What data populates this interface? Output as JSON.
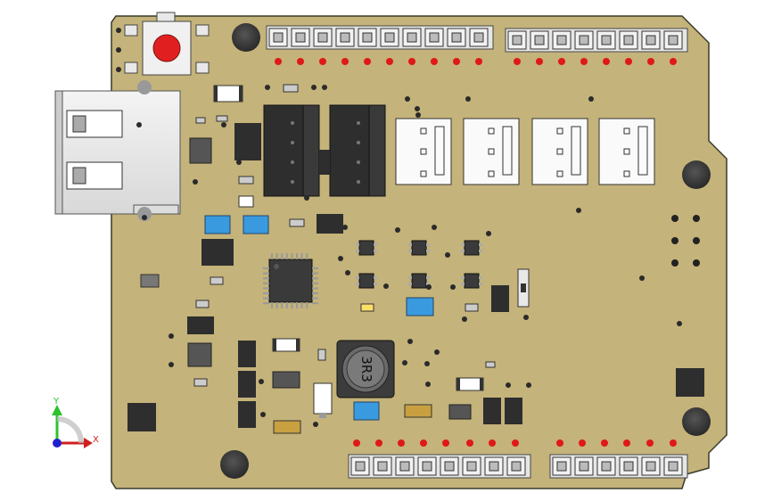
{
  "board": {
    "color": "#c4b37a",
    "outline_color": "#3a3a2a",
    "inductor_marking": "3R3",
    "button_color": "#e02020",
    "led_color": "#e01818",
    "chip_color": "#2e2e2e",
    "blue_component_color": "#3a9ae0",
    "cap_tan_color": "#c8a040"
  },
  "axis_triad": {
    "y_label": "Y",
    "x_label": "X",
    "y_color": "#2ec22e",
    "x_color": "#d02020",
    "z_color": "#2020d0"
  }
}
